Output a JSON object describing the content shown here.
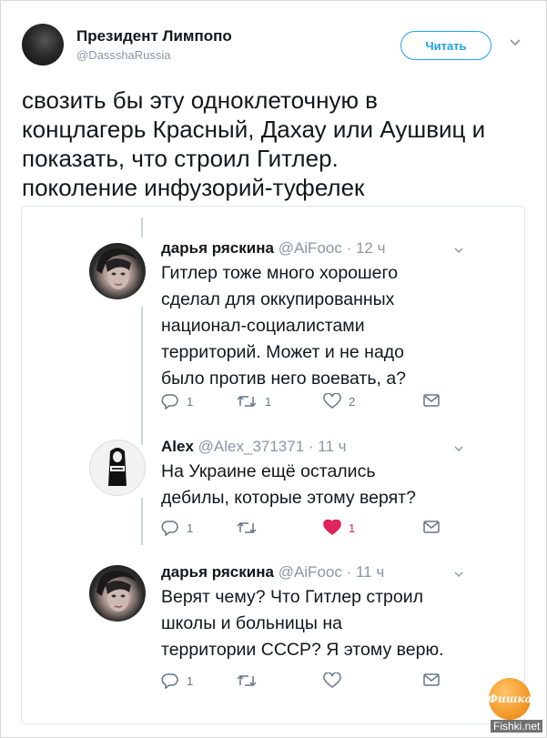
{
  "tweet": {
    "author_name": "Президент Лимпопо",
    "author_handle": "@DassshaRussia",
    "follow_label": "Читать",
    "text_lines": [
      "свозить бы эту одноклеточную в",
      "концлагерь Красный, Дахау или Аушвиц и",
      "показать, что строил Гитлер.",
      "поколение инфузорий-туфелек"
    ]
  },
  "replies": [
    {
      "name": "дарья ряскина",
      "handle": "@AiFooc",
      "time": "· 12 ч",
      "body_lines": [
        "Гитлер тоже много хорошего",
        "сделал для оккупированных",
        "национал-социалистами",
        "территорий. Может и не надо",
        "было против него воевать, а?"
      ],
      "replies_count": "1",
      "retweets_count": "1",
      "likes_count": "2",
      "liked": false
    },
    {
      "name": "Alex",
      "handle": "@Alex_371371",
      "time": "· 11 ч",
      "body_lines": [
        "На Украине ещё остались",
        "дебилы, которые этому верят?"
      ],
      "replies_count": "1",
      "retweets_count": "",
      "likes_count": "1",
      "liked": true
    },
    {
      "name": "дарья ряскина",
      "handle": "@AiFooc",
      "time": "· 11 ч",
      "body_lines": [
        "Верят чему? Что Гитлер строил",
        "школы и больницы на",
        "территории СССР? Я этому верю."
      ],
      "replies_count": "1",
      "retweets_count": "",
      "likes_count": "",
      "liked": false
    }
  ],
  "logo_text": "Фишка",
  "watermark": "Fishki.net",
  "colors": {
    "accent": "#1da1f2",
    "like": "#e0245e",
    "muted": "#657786"
  },
  "icons": [
    "reply-icon",
    "retweet-icon",
    "heart-icon",
    "message-icon",
    "chevron-down-icon"
  ]
}
